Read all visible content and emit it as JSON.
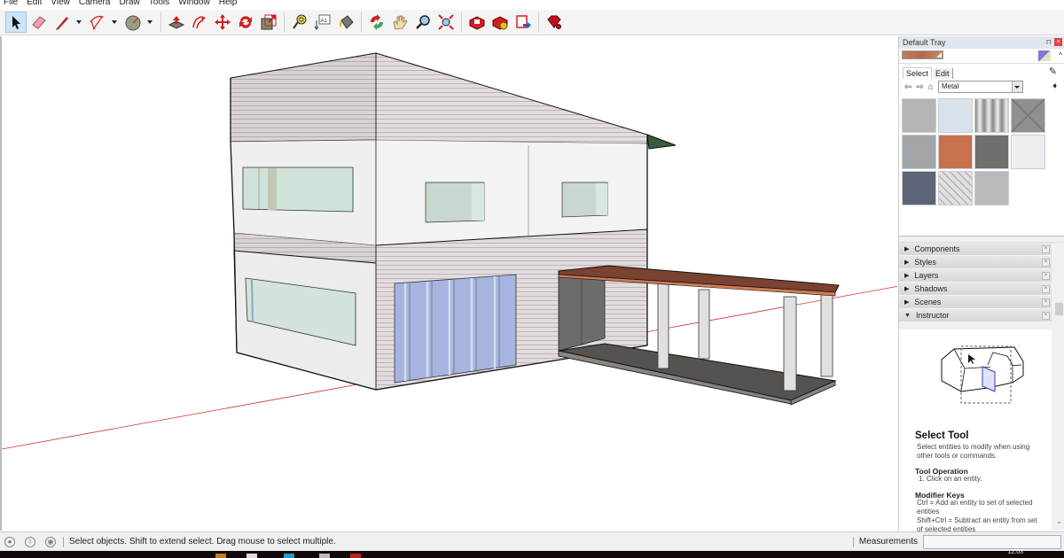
{
  "menu": [
    "File",
    "Edit",
    "View",
    "Camera",
    "Draw",
    "Tools",
    "Window",
    "Help"
  ],
  "toolbar": {
    "tools": [
      {
        "name": "select-tool",
        "icon": "cursor-arrow-icon",
        "active": true
      },
      {
        "name": "eraser-tool",
        "icon": "eraser-icon"
      },
      {
        "name": "line-tool",
        "icon": "pencil-icon",
        "dropdown": true
      },
      {
        "name": "arc-tool",
        "icon": "arc-icon",
        "dropdown": true
      },
      {
        "name": "circle-tool",
        "icon": "circle-icon",
        "dropdown": true
      },
      {
        "name": "push-pull-tool",
        "icon": "push-pull-icon"
      },
      {
        "name": "offset-tool",
        "icon": "offset-icon"
      },
      {
        "name": "move-tool",
        "icon": "move-icon"
      },
      {
        "name": "rotate-tool",
        "icon": "rotate-icon"
      },
      {
        "name": "scale-tool",
        "icon": "scale-icon"
      },
      {
        "name": "tape-measure-tool",
        "icon": "tape-measure-icon"
      },
      {
        "name": "text-tool",
        "icon": "text-label-icon"
      },
      {
        "name": "paint-bucket-tool",
        "icon": "paint-bucket-icon"
      },
      {
        "name": "orbit-tool",
        "icon": "orbit-icon"
      },
      {
        "name": "pan-tool",
        "icon": "hand-icon"
      },
      {
        "name": "zoom-tool",
        "icon": "magnifier-icon"
      },
      {
        "name": "zoom-extents-tool",
        "icon": "zoom-extents-icon"
      },
      {
        "name": "3d-warehouse",
        "icon": "warehouse-icon"
      },
      {
        "name": "extension-warehouse",
        "icon": "extension-warehouse-icon"
      },
      {
        "name": "send-to-layout",
        "icon": "layout-icon"
      },
      {
        "name": "extension-manager",
        "icon": "ruby-gem-icon"
      }
    ],
    "text_tool_label": "A1"
  },
  "tray": {
    "title": "Default Tray",
    "materials": {
      "tabs": [
        "Select",
        "Edit"
      ],
      "collection": "Metal",
      "swatches": [
        {
          "name": "metal-aluminum",
          "color": "#b4b4b4"
        },
        {
          "name": "metal-frosted",
          "color": "#d9e1ea"
        },
        {
          "name": "metal-corrugated",
          "color": "#a8a8a8"
        },
        {
          "name": "metal-panel-cross",
          "color": "#8f8f8f"
        },
        {
          "name": "metal-galvanized",
          "color": "#a3a6a8"
        },
        {
          "name": "metal-rusted",
          "color": "#c8714f"
        },
        {
          "name": "metal-dark-steel",
          "color": "#6f706d"
        },
        {
          "name": "metal-white",
          "color": "#eceef2"
        },
        {
          "name": "metal-blue-perforated",
          "color": "#5c6478"
        },
        {
          "name": "metal-diamond-plate",
          "color": "#cfd0d2"
        },
        {
          "name": "metal-steel-plain",
          "color": "#b6babc"
        }
      ]
    },
    "panels": [
      {
        "label": "Components",
        "expanded": false
      },
      {
        "label": "Styles",
        "expanded": false
      },
      {
        "label": "Layers",
        "expanded": false
      },
      {
        "label": "Shadows",
        "expanded": false
      },
      {
        "label": "Scenes",
        "expanded": false
      },
      {
        "label": "Instructor",
        "expanded": true
      }
    ],
    "instructor": {
      "title": "Select Tool",
      "description": "Select entities to modify when using other tools or commands.",
      "operation_heading": "Tool Operation",
      "operation_text": "1. Click on an entity.",
      "modifier_heading": "Modifier Keys",
      "modifier_text_1": "Ctrl = Add an entity to set of selected entities",
      "modifier_text_2": "Shift+Ctrl = Subtract an entity from set of selected entities"
    }
  },
  "status": {
    "message": "Select objects. Shift to extend select. Drag mouse to select multiple.",
    "measurements_label": "Measurements",
    "measurements_value": ""
  },
  "taskbar": {
    "clock": "12:03"
  }
}
